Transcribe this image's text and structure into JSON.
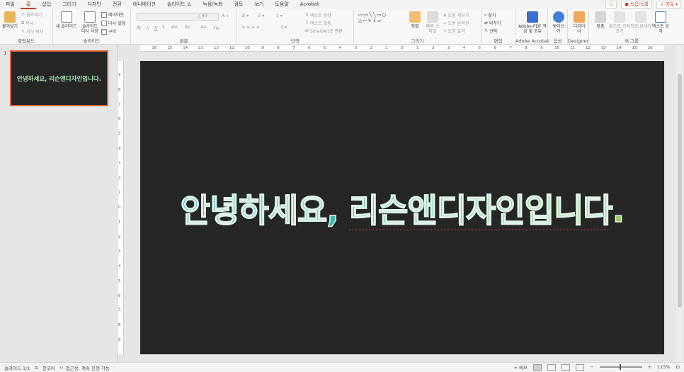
{
  "ribbon_tabs": [
    "파일",
    "홈",
    "삽입",
    "그리기",
    "디자인",
    "전환",
    "애니메이션",
    "슬라이드 쇼",
    "녹음/녹화",
    "검토",
    "보기",
    "도움말",
    "Acrobat"
  ],
  "active_tab_index": 1,
  "top_right": {
    "comment_icon": "comment-icon",
    "record_label": "녹음/녹화",
    "share_label": "공유"
  },
  "groups": {
    "clipboard": {
      "label": "클립보드",
      "paste": "붙여넣기",
      "cut": "잘라내기",
      "copy": "복사",
      "format_painter": "서식 복사"
    },
    "slides": {
      "label": "슬라이드",
      "new_slide": "새 슬라이드",
      "reuse_slide": "슬라이드 다시 사용",
      "layout": "레이아웃",
      "reset": "다시 설정",
      "section": "구역"
    },
    "font": {
      "label": "글꼴",
      "font_size": "40"
    },
    "paragraph": {
      "label": "단락",
      "text_direction": "텍스트 방향",
      "align_text": "텍스트 맞춤",
      "smartart": "SmartArt로 변환"
    },
    "drawing": {
      "label": "그리기",
      "arrange": "정렬",
      "quick_styles": "빠른 스타일",
      "shape_fill": "도형 채우기",
      "shape_outline": "도형 윤곽선",
      "shape_effects": "도형 효과"
    },
    "editing": {
      "label": "편집",
      "find": "찾기",
      "replace": "바꾸기",
      "select": "선택"
    },
    "acrobat": {
      "label": "Adobe Acrobat",
      "create_pdf": "Adobe PDF 작성 및 공유"
    },
    "voice": {
      "label": "음성",
      "dictate": "받아쓰기"
    },
    "designer": {
      "label": "Designer",
      "designer_btn": "디자이너"
    },
    "new_group": {
      "label": "새 그룹",
      "align": "맞춤",
      "bring_forward": "앞으로 가져오기",
      "send_backward": "뒤로 보내기",
      "textbox": "텍스트 상자"
    }
  },
  "slides_pane": {
    "slide_number": "1",
    "thumb_text": "안녕하세요, 리슨앤디자인입니다."
  },
  "hruler_labels": [
    "16",
    "15",
    "14",
    "13",
    "12",
    "11",
    "10",
    "9",
    "8",
    "7",
    "6",
    "5",
    "4",
    "3",
    "2",
    "1",
    "0",
    "1",
    "2",
    "3",
    "4",
    "5",
    "6",
    "7",
    "8",
    "9",
    "10",
    "11",
    "12",
    "13",
    "14",
    "15",
    "16"
  ],
  "vruler_labels": [
    "9",
    "8",
    "7",
    "6",
    "5",
    "4",
    "3",
    "2",
    "1",
    "0",
    "1",
    "2",
    "3",
    "4",
    "5",
    "6",
    "7",
    "8",
    "9"
  ],
  "slide": {
    "title": "안녕하세요, 리슨앤디자인입니다."
  },
  "status_bar": {
    "slide_info": "슬라이드 1/1",
    "language": "한국어",
    "accessibility": "접근성: 계속 진행 가능",
    "notes": "메모",
    "zoom": "115%"
  },
  "colors": {
    "accent": "#c43e1c",
    "slide_bg": "#262626",
    "text_grad_start": "#1ea7d8",
    "text_grad_end": "#9ccc5f"
  }
}
